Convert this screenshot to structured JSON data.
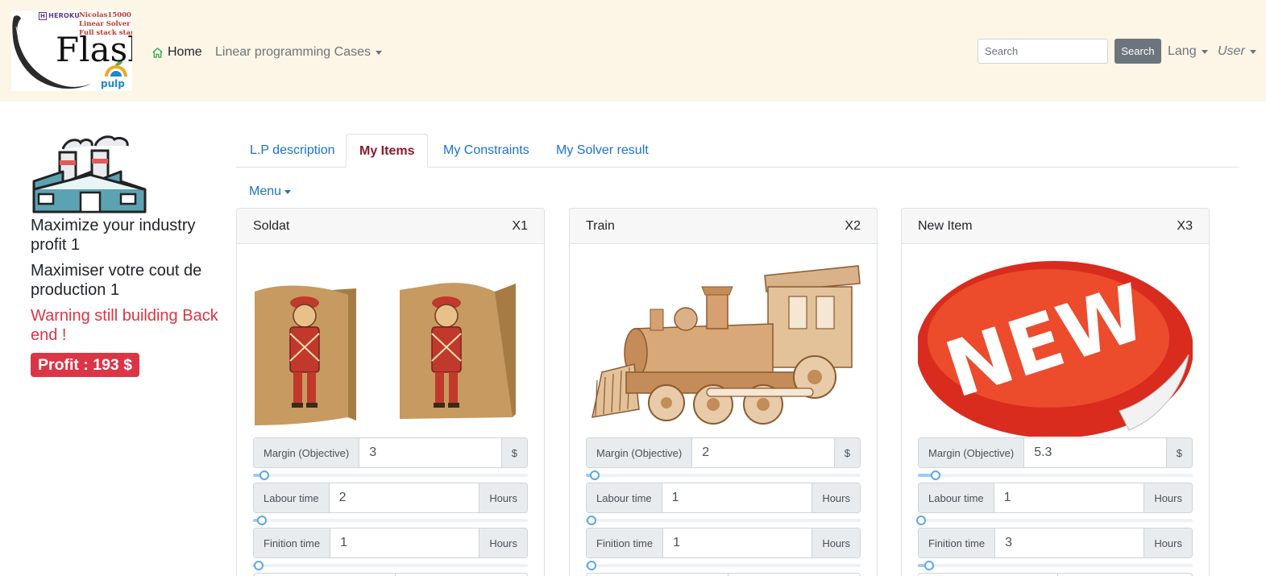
{
  "logo": {
    "heroku": "HEROKU",
    "notes": [
      "Nicolas15000",
      "Linear Solver",
      "Full stack starter"
    ],
    "flask": "Flask",
    "pulp": "pulp"
  },
  "nav": {
    "home": "Home",
    "cases": "Linear programming Cases",
    "search_placeholder": "Search",
    "search_button": "Search",
    "lang": "Lang",
    "user": "User"
  },
  "left": {
    "line1": "Maximize your industry profit 1",
    "line2": "Maximiser votre cout de production 1",
    "warning": "Warning still building Back end !",
    "profit": "Profit : 193 $"
  },
  "tabs": [
    "L.P description",
    "My Items",
    "My Constraints",
    "My Solver result"
  ],
  "active_tab": "My Items",
  "menu": "Menu",
  "items": [
    {
      "name": "Soldat",
      "var": "X1",
      "image": "wooden-soldier-bookends",
      "fields": [
        {
          "label": "Margin (Objective)",
          "value": "3",
          "unit": "$",
          "slider_fraction": 0.03
        },
        {
          "label": "Labour time",
          "value": "2",
          "unit": "Hours",
          "slider_fraction": 0.02
        },
        {
          "label": "Finition time",
          "value": "1",
          "unit": "Hours",
          "slider_fraction": 0.01
        }
      ]
    },
    {
      "name": "Train",
      "var": "X2",
      "image": "wooden-toy-train",
      "fields": [
        {
          "label": "Margin (Objective)",
          "value": "2",
          "unit": "$",
          "slider_fraction": 0.02
        },
        {
          "label": "Labour time",
          "value": "1",
          "unit": "Hours",
          "slider_fraction": 0.01
        },
        {
          "label": "Finition time",
          "value": "1",
          "unit": "Hours",
          "slider_fraction": 0.01
        }
      ]
    },
    {
      "name": "New Item",
      "var": "X3",
      "image": "new-sticker",
      "fields": [
        {
          "label": "Margin (Objective)",
          "value": "5.3",
          "unit": "$",
          "slider_fraction": 0.053
        },
        {
          "label": "Labour time",
          "value": "1",
          "unit": "Hours",
          "slider_fraction": 0.0
        },
        {
          "label": "Finition time",
          "value": "3",
          "unit": "Hours",
          "slider_fraction": 0.03
        }
      ]
    }
  ],
  "colors": {
    "navbar_bg": "#fdf5e6",
    "link": "#1a73c9",
    "active_tab": "#8b1a2b",
    "danger": "#dc3545",
    "slider": "#5aa9e6"
  }
}
